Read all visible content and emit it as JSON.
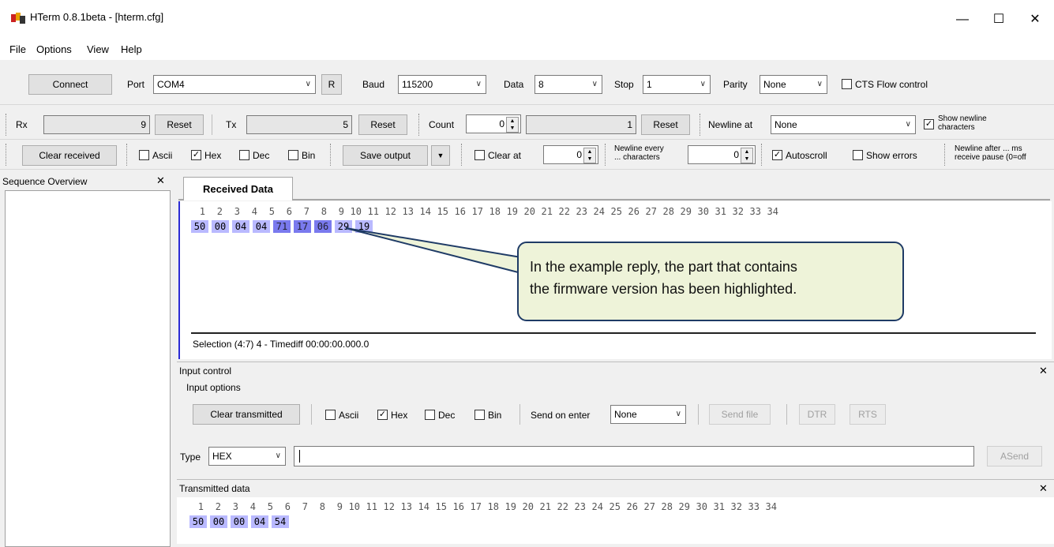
{
  "window": {
    "title": "HTerm 0.8.1beta - [hterm.cfg]",
    "minimize": "—",
    "maximize": "☐",
    "close": "✕"
  },
  "menu": [
    "File",
    "Options",
    "View",
    "Help"
  ],
  "connection": {
    "connect": "Connect",
    "port_label": "Port",
    "port_value": "COM4",
    "r_button": "R",
    "baud_label": "Baud",
    "baud_value": "115200",
    "data_label": "Data",
    "data_value": "8",
    "stop_label": "Stop",
    "stop_value": "1",
    "parity_label": "Parity",
    "parity_value": "None",
    "cts_label": "CTS Flow control"
  },
  "counters": {
    "rx_label": "Rx",
    "rx_value": "9",
    "reset1": "Reset",
    "tx_label": "Tx",
    "tx_value": "5",
    "reset2": "Reset",
    "count_label": "Count",
    "count_value": "0",
    "count_field": "1",
    "reset3": "Reset",
    "newline_at_label": "Newline at",
    "newline_at_value": "None",
    "show_newline_1": "Show newline",
    "show_newline_2": "characters"
  },
  "display": {
    "clear_received": "Clear received",
    "ascii": "Ascii",
    "hex": "Hex",
    "dec": "Dec",
    "bin": "Bin",
    "save_output": "Save output",
    "clear_at": "Clear at",
    "clear_at_value": "0",
    "newline_every_1": "Newline every",
    "newline_every_2": "... characters",
    "newline_every_value": "0",
    "autoscroll": "Autoscroll",
    "show_errors": "Show errors",
    "newline_after_1": "Newline after ... ms",
    "newline_after_2": "receive pause (0=off"
  },
  "sequence": {
    "title": "Sequence Overview",
    "close": "✕"
  },
  "received": {
    "tab": "Received Data",
    "indices": [
      "1",
      "2",
      "3",
      "4",
      "5",
      "6",
      "7",
      "8",
      "9",
      "10",
      "11",
      "12",
      "13",
      "14",
      "15",
      "16",
      "17",
      "18",
      "19",
      "20",
      "21",
      "22",
      "23",
      "24",
      "25",
      "26",
      "27",
      "28",
      "29",
      "30",
      "31",
      "32",
      "33",
      "34"
    ],
    "bytes": [
      "50",
      "00",
      "04",
      "04",
      "71",
      "17",
      "06",
      "29",
      "19"
    ],
    "status": "Selection (4:7) 4  -  Timediff 00:00:00.000.0",
    "callout": [
      "In the example reply, the part that contains",
      "the firmware version has been highlighted."
    ]
  },
  "input": {
    "title": "Input control",
    "close": "✕",
    "options_label": "Input options",
    "clear_transmitted": "Clear transmitted",
    "ascii": "Ascii",
    "hex": "Hex",
    "dec": "Dec",
    "bin": "Bin",
    "send_on_enter_label": "Send on enter",
    "send_on_enter_value": "None",
    "send_file": "Send file",
    "dtr": "DTR",
    "rts": "RTS",
    "type_label": "Type",
    "type_value": "HEX",
    "asend": "ASend"
  },
  "transmitted": {
    "title": "Transmitted data",
    "close": "✕",
    "indices": [
      "1",
      "2",
      "3",
      "4",
      "5",
      "6",
      "7",
      "8",
      "9",
      "10",
      "11",
      "12",
      "13",
      "14",
      "15",
      "16",
      "17",
      "18",
      "19",
      "20",
      "21",
      "22",
      "23",
      "24",
      "25",
      "26",
      "27",
      "28",
      "29",
      "30",
      "31",
      "32",
      "33",
      "34"
    ],
    "bytes": [
      "50",
      "00",
      "00",
      "04",
      "54"
    ]
  }
}
